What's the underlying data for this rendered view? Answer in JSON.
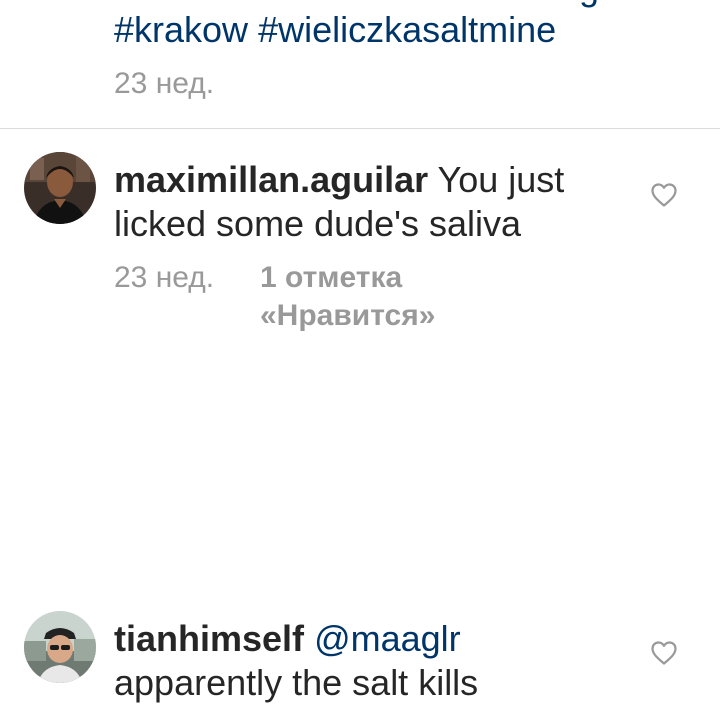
{
  "caption": {
    "hashtags": [
      "#krakow",
      "#wieliczkasaltmine"
    ],
    "time": "23 нед."
  },
  "comments": [
    {
      "username": "maximillan.aguilar",
      "text": "You just licked some dude's saliva",
      "time": "23 нед.",
      "likes": "1 отметка «Нравится»",
      "avatar_icon": "user-avatar",
      "like_icon": "heart-outline-icon"
    },
    {
      "username": "tianhimself",
      "mention": "@maaglr",
      "text": "apparently the salt kills",
      "avatar_icon": "user-avatar",
      "like_icon": "heart-outline-icon"
    }
  ],
  "colors": {
    "link": "#003569",
    "text": "#262626",
    "muted": "#999999",
    "divider": "#dbdbdb"
  }
}
